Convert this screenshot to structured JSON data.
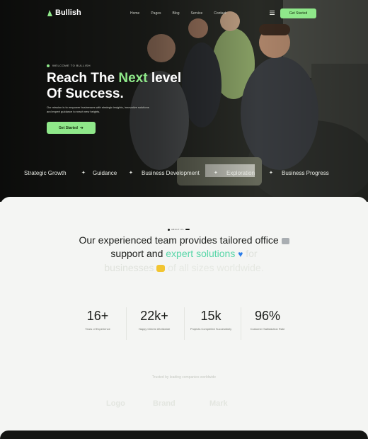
{
  "nav": {
    "brand": "Bullish",
    "menu": [
      "Home",
      "Pages",
      "Blog",
      "Service",
      "Contact"
    ],
    "cta": "Get Started"
  },
  "hero": {
    "eyebrow": "WELCOME TO BULLISH",
    "title_a": "Reach The",
    "title_hl": "Next",
    "title_b": "level",
    "title_c": "Of Success.",
    "description": "Our mission is to empower businesses with strategic insights, innovative solutions and expert guidance to reach new heights.",
    "button": "Get Started",
    "button_icon": "arrow-right-icon"
  },
  "marquee": [
    "Strategic Growth",
    "Guidance",
    "Business Development",
    "Exploration",
    "Business Progress"
  ],
  "about": {
    "badge": "ABOUT US",
    "line1_a": "Our experienced team provides tailored office",
    "line2_a": "support and",
    "line2_g": "expert solutions",
    "line2_f": "for",
    "line3": "businesses",
    "line3_f": "of all sizes worldwide."
  },
  "stats": [
    {
      "value": "16+",
      "label": "Years of Experience"
    },
    {
      "value": "22k+",
      "label": "Happy Clients Worldwide"
    },
    {
      "value": "15k",
      "label": "Projects Completed Successfully"
    },
    {
      "value": "96%",
      "label": "Customer Satisfaction Rate"
    }
  ],
  "clients": {
    "caption": "Trusted by leading companies worldwide",
    "logos": [
      "Logo",
      "Brand",
      "Mark"
    ]
  },
  "colors": {
    "accent": "#8fe88a",
    "highlight": "#58d6a8",
    "dark": "#141513",
    "light_bg": "#f4f5f3"
  }
}
